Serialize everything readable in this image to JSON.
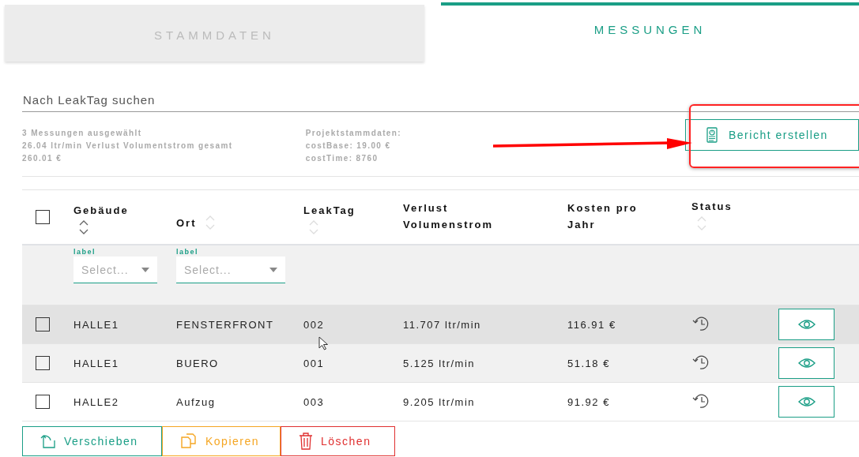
{
  "tabs": [
    {
      "label": "STAMMDATEN",
      "selected": false
    },
    {
      "label": "MESSUNGEN",
      "selected": true
    }
  ],
  "search": {
    "placeholder": "Nach LeakTag suchen"
  },
  "summary": [
    "3 Messungen ausgewählt",
    "26.04 ltr/min Verlust Volumentstrom gesamt",
    "260.01 €"
  ],
  "project": [
    "Projektstammdaten:",
    "costBase: 19.00 €",
    "costTime: 8760"
  ],
  "report_button": "Bericht erstellen",
  "table": {
    "select_all": {
      "checked": false
    },
    "columns": [
      {
        "label": "Gebäude",
        "sorted": true
      },
      {
        "label": "Ort",
        "sorted": false
      },
      {
        "label": "LeakTag",
        "sorted": false
      },
      {
        "label": "Verlust Volumenstrom"
      },
      {
        "label": "Kosten pro Jahr"
      },
      {
        "label": "Status",
        "sorted": false
      }
    ],
    "filters": [
      {
        "label": "label",
        "placeholder": "Select..."
      },
      {
        "label": "label",
        "placeholder": "Select..."
      }
    ],
    "rows": [
      {
        "checked": false,
        "hovered": true,
        "cells": [
          "HALLE1",
          "FENSTERFRONT",
          "002",
          "11.707 ltr/min",
          "116.91 €"
        ]
      },
      {
        "checked": false,
        "hovered": false,
        "cells": [
          "HALLE1",
          "BUERO",
          "001",
          "5.125 ltr/min",
          "51.18 €"
        ]
      },
      {
        "checked": false,
        "hovered": false,
        "cells": [
          "HALLE2",
          "Aufzug",
          "003",
          "9.205 ltr/min",
          "91.92 €"
        ]
      }
    ]
  },
  "actions": [
    {
      "label": "Verschieben",
      "kind": "move"
    },
    {
      "label": "Kopieren",
      "kind": "copy"
    },
    {
      "label": "Löschen",
      "kind": "delete"
    }
  ]
}
